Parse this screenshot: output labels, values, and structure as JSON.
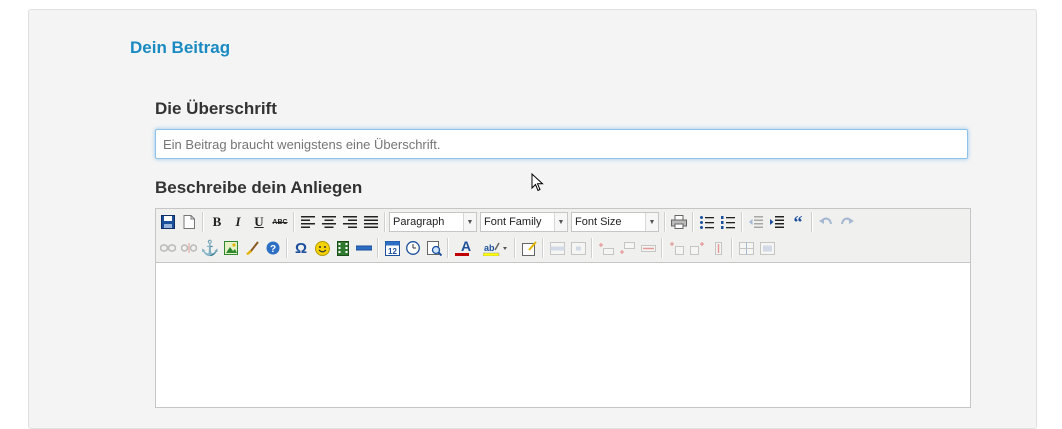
{
  "section": {
    "title": "Dein Beitrag"
  },
  "form": {
    "title_label": "Die Überschrift",
    "title_placeholder": "Ein Beitrag braucht wenigstens eine Überschrift.",
    "description_label": "Beschreibe dein Anliegen",
    "description_value": ""
  },
  "toolbar": {
    "format_select": "Paragraph",
    "font_family_select": "Font Family",
    "font_size_select": "Font Size",
    "bold_glyph": "B",
    "italic_glyph": "I",
    "underline_glyph": "U",
    "strike_glyph": "ABC",
    "omega_glyph": "Ω",
    "smiley_glyph": "🙂",
    "quote_glyph": "“",
    "color_a_glyph": "A",
    "icons_row1": [
      "save-icon",
      "new-document-icon",
      "bold-icon",
      "italic-icon",
      "underline-icon",
      "strikethrough-icon",
      "align-left-icon",
      "align-center-icon",
      "align-right-icon",
      "align-justify-icon",
      "print-icon",
      "bullet-list-icon",
      "numbered-list-icon",
      "outdent-icon",
      "indent-icon",
      "blockquote-icon",
      "undo-icon",
      "redo-icon"
    ],
    "icons_row2": [
      "link-icon",
      "unlink-icon",
      "anchor-icon",
      "image-icon",
      "cleanup-icon",
      "help-icon",
      "special-char-icon",
      "emoticon-icon",
      "media-icon",
      "horizontal-rule-icon",
      "insert-date-icon",
      "insert-time-icon",
      "preview-icon",
      "text-color-icon",
      "background-color-icon",
      "edit-source-icon",
      "table-row-props-icon",
      "table-cell-props-icon",
      "insert-row-before-icon",
      "insert-row-after-icon",
      "delete-row-icon",
      "insert-col-before-icon",
      "insert-col-after-icon",
      "delete-col-icon",
      "split-cells-icon",
      "merge-cells-icon"
    ],
    "colors": {
      "icon_blue": "#1c4f9c",
      "icon_green": "#2f8a2f",
      "icon_yellow": "#e3b400",
      "color_red": "#c00000",
      "highlight_yellow": "#ffff00"
    }
  }
}
